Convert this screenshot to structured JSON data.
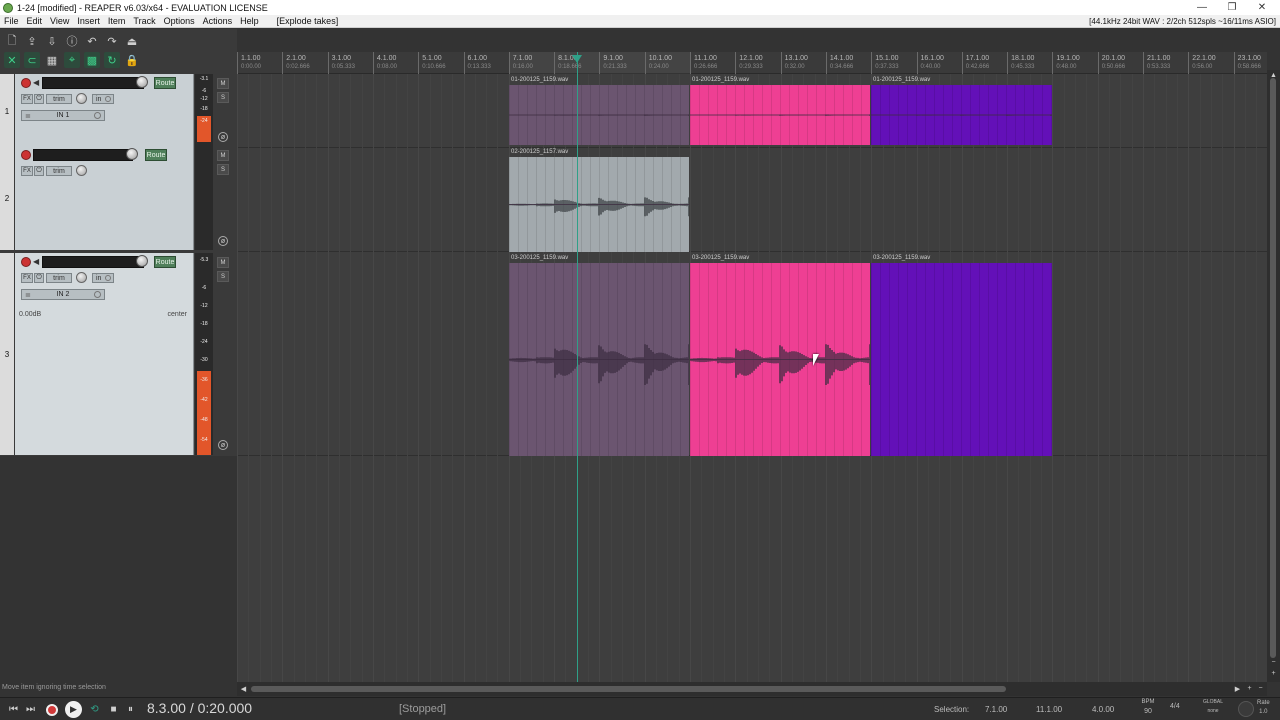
{
  "window": {
    "title": "1-24 [modified] - REAPER v6.03/x64 - EVALUATION LICENSE",
    "minimize": "—",
    "restore": "❐",
    "close": "✕"
  },
  "menu": {
    "items": [
      "File",
      "Edit",
      "View",
      "Insert",
      "Item",
      "Track",
      "Options",
      "Actions",
      "Help"
    ],
    "explode": "[Explode takes]",
    "audio_status": "[44.1kHz 24bit WAV : 2/2ch 512spls ~16/11ms ASIO]"
  },
  "ruler": {
    "ticks": [
      {
        "bar": "1.1.00",
        "time": "0:00.00"
      },
      {
        "bar": "2.1.00",
        "time": "0:02.666"
      },
      {
        "bar": "3.1.00",
        "time": "0:05.333"
      },
      {
        "bar": "4.1.00",
        "time": "0:08.00"
      },
      {
        "bar": "5.1.00",
        "time": "0:10.666"
      },
      {
        "bar": "6.1.00",
        "time": "0:13.333"
      },
      {
        "bar": "7.1.00",
        "time": "0:16.00"
      },
      {
        "bar": "8.1.00",
        "time": "0:18.666"
      },
      {
        "bar": "9.1.00",
        "time": "0:21.333"
      },
      {
        "bar": "10.1.00",
        "time": "0:24.00"
      },
      {
        "bar": "11.1.00",
        "time": "0:26.666"
      },
      {
        "bar": "12.1.00",
        "time": "0:29.333"
      },
      {
        "bar": "13.1.00",
        "time": "0:32.00"
      },
      {
        "bar": "14.1.00",
        "time": "0:34.666"
      },
      {
        "bar": "15.1.00",
        "time": "0:37.333"
      },
      {
        "bar": "16.1.00",
        "time": "0:40.00"
      },
      {
        "bar": "17.1.00",
        "time": "0:42.666"
      },
      {
        "bar": "18.1.00",
        "time": "0:45.333"
      },
      {
        "bar": "19.1.00",
        "time": "0:48.00"
      },
      {
        "bar": "20.1.00",
        "time": "0:50.666"
      },
      {
        "bar": "21.1.00",
        "time": "0:53.333"
      },
      {
        "bar": "22.1.00",
        "time": "0:56.00"
      },
      {
        "bar": "23.1.00",
        "time": "0:58.666"
      }
    ]
  },
  "tracks": [
    {
      "num": "1",
      "route": "Route",
      "fx": "FX",
      "trim": "trim",
      "in": "in",
      "input": "IN 1",
      "meter_top": "-3.1",
      "meter_scale": [
        "-6",
        "-12",
        "-18",
        "-24"
      ]
    },
    {
      "num": "2",
      "route": "Route",
      "fx": "FX",
      "trim": "trim"
    },
    {
      "num": "3",
      "route": "Route",
      "fx": "FX",
      "trim": "trim",
      "in": "in",
      "input": "IN 2",
      "volume": "0.00dB",
      "pan": "center",
      "meter_top": "-5.3",
      "meter_scale": [
        "-6",
        "-12",
        "-18",
        "-24",
        "-30",
        "-36",
        "-42",
        "-48",
        "-54"
      ]
    }
  ],
  "ms": {
    "mute": "M",
    "solo": "S",
    "phase": "ø"
  },
  "items": [
    {
      "lane": 0,
      "label": "01-200125_1159.wav",
      "color": "#6b5570"
    },
    {
      "lane": 0,
      "label": "01-200125_1159.wav",
      "color": "#ee3f93"
    },
    {
      "lane": 0,
      "label": "01-200125_1159.wav",
      "color": "#6310b8"
    },
    {
      "lane": 1,
      "label": "02-200125_1157.wav",
      "color": "#a2a9ad"
    },
    {
      "lane": 2,
      "label": "03-200125_1159.wav",
      "color": "#6b5570"
    },
    {
      "lane": 2,
      "label": "03-200125_1159.wav",
      "color": "#ee3f93"
    },
    {
      "lane": 2,
      "label": "03-200125_1159.wav",
      "color": "#6310b8"
    }
  ],
  "status": {
    "message": "Move item ignoring time selection"
  },
  "transport": {
    "position": "8.3.00 / 0:20.000",
    "state": "[Stopped]",
    "selection_label": "Selection:",
    "sel_start": "7.1.00",
    "sel_end": "11.1.00",
    "sel_length": "4.0.00",
    "bpm_label": "BPM",
    "bpm": "90",
    "time_sig": "4/4",
    "global_label": "GLOBAL",
    "global_mode": "none",
    "rate_label": "Rate",
    "rate": "1.0"
  },
  "colors": {
    "accent": "#2fa088",
    "record": "#d13a3a",
    "meter": "#e2562a"
  }
}
